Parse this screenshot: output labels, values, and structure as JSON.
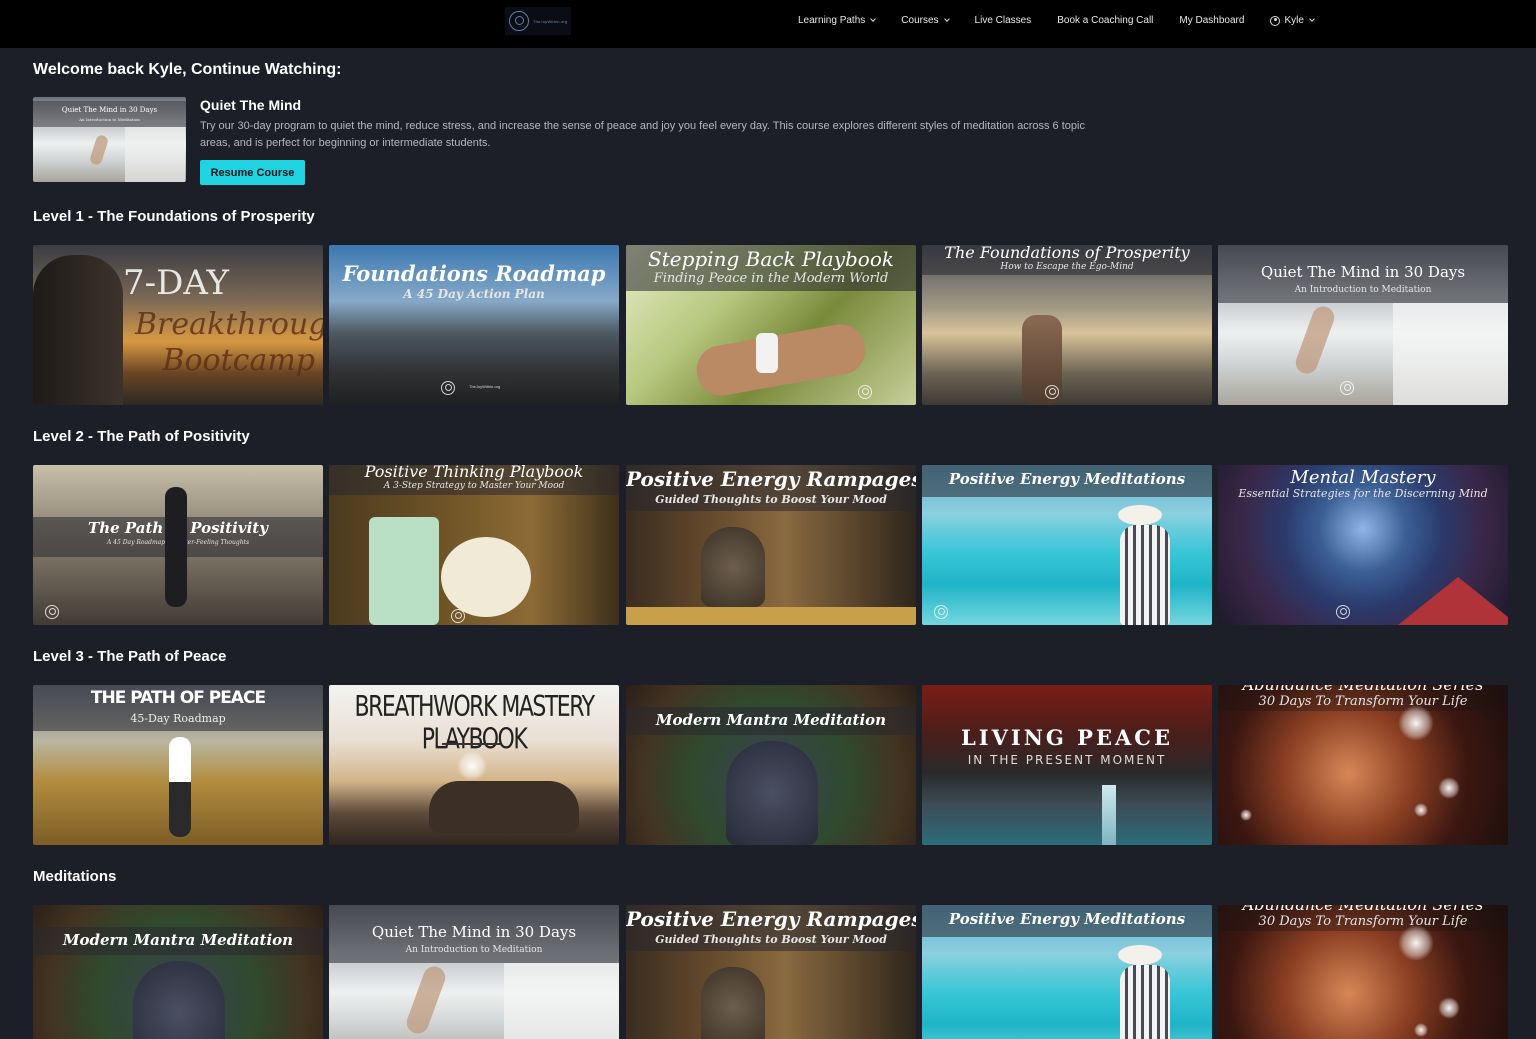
{
  "nav": {
    "logo_text": "TheJoyWithin.org",
    "items": [
      {
        "label": "Learning  Paths",
        "dropdown": true
      },
      {
        "label": "Courses",
        "dropdown": true
      },
      {
        "label": "Live Classes",
        "dropdown": false
      },
      {
        "label": "Book a Coaching Call",
        "dropdown": false
      },
      {
        "label": "My Dashboard",
        "dropdown": false
      }
    ],
    "user_label": "Kyle"
  },
  "continue": {
    "heading": "Welcome back Kyle, Continue Watching:",
    "thumb_title": "Quiet The Mind in 30 Days",
    "thumb_subtitle": "An Introduction to Meditation",
    "course_title": "Quiet The Mind",
    "description": "Try our 30-day program to quiet the mind, reduce stress, and increase the sense of peace and joy you feel every day. This course explores different styles of meditation across 6 topic areas, and is perfect for beginning or intermediate students.",
    "button_label": "Resume Course"
  },
  "sections": {
    "level1": {
      "title": "Level 1 - The Foundations of Prosperity",
      "cards": [
        {
          "title": "7-DAY",
          "subtitle": "Breakthrough Bootcamp"
        },
        {
          "title": "Foundations Roadmap",
          "subtitle": "A 45 Day Action Plan"
        },
        {
          "title": "Stepping Back Playbook",
          "subtitle": "Finding Peace in the Modern World"
        },
        {
          "title": "The Foundations of Prosperity",
          "subtitle": "How to Escape the Ego-Mind"
        },
        {
          "title": "Quiet The Mind in 30 Days",
          "subtitle": "An Introduction to Meditation"
        }
      ]
    },
    "level2": {
      "title": "Level 2 - The Path of Positivity",
      "cards": [
        {
          "title": "The Path of Positivity",
          "subtitle": "A 45 Day Roadmap to Better-Feeling Thoughts"
        },
        {
          "title": "Positive Thinking Playbook",
          "subtitle": "A 3-Step Strategy to Master Your Mood"
        },
        {
          "title": "Positive Energy Rampages",
          "subtitle": "Guided Thoughts to Boost Your Mood"
        },
        {
          "title": "Positive Energy Meditations",
          "subtitle": ""
        },
        {
          "title": "Mental Mastery",
          "subtitle": "Essential Strategies for the Discerning Mind"
        }
      ]
    },
    "level3": {
      "title": "Level 3 - The Path of Peace",
      "cards": [
        {
          "title": "THE PATH OF PEACE",
          "subtitle": "45-Day Roadmap"
        },
        {
          "title": "BREATHWORK MASTERY PLAYBOOK",
          "subtitle": ""
        },
        {
          "title": "Modern Mantra Meditation",
          "subtitle": ""
        },
        {
          "title": "LIVING PEACE",
          "subtitle": "IN THE PRESENT MOMENT"
        },
        {
          "title": "Abundance Meditation Series",
          "subtitle": "30 Days To Transform Your Life"
        }
      ]
    },
    "meditations": {
      "title": "Meditations",
      "cards": [
        {
          "title": "Modern Mantra Meditation",
          "subtitle": ""
        },
        {
          "title": "Quiet The Mind in 30 Days",
          "subtitle": "An Introduction to Meditation"
        },
        {
          "title": "Positive Energy Rampages",
          "subtitle": "Guided Thoughts to Boost Your Mood"
        },
        {
          "title": "Positive Energy Meditations",
          "subtitle": ""
        },
        {
          "title": "Abundance Meditation Series",
          "subtitle": "30 Days To Transform Your Life"
        }
      ]
    }
  },
  "watermark_text": "TheJoyWithin.org",
  "colors": {
    "page_bg": "#1d1f28",
    "nav_bg": "#000000",
    "accent": "#1fd3e0"
  }
}
